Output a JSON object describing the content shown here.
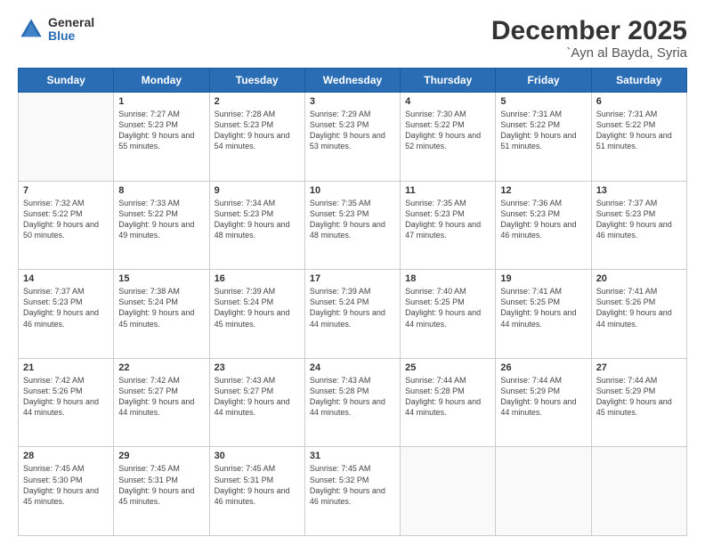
{
  "logo": {
    "general": "General",
    "blue": "Blue"
  },
  "header": {
    "month": "December 2025",
    "location": "`Ayn al Bayda, Syria"
  },
  "weekdays": [
    "Sunday",
    "Monday",
    "Tuesday",
    "Wednesday",
    "Thursday",
    "Friday",
    "Saturday"
  ],
  "weeks": [
    [
      {
        "day": "",
        "sunrise": "",
        "sunset": "",
        "daylight": ""
      },
      {
        "day": "1",
        "sunrise": "Sunrise: 7:27 AM",
        "sunset": "Sunset: 5:23 PM",
        "daylight": "Daylight: 9 hours and 55 minutes."
      },
      {
        "day": "2",
        "sunrise": "Sunrise: 7:28 AM",
        "sunset": "Sunset: 5:23 PM",
        "daylight": "Daylight: 9 hours and 54 minutes."
      },
      {
        "day": "3",
        "sunrise": "Sunrise: 7:29 AM",
        "sunset": "Sunset: 5:23 PM",
        "daylight": "Daylight: 9 hours and 53 minutes."
      },
      {
        "day": "4",
        "sunrise": "Sunrise: 7:30 AM",
        "sunset": "Sunset: 5:22 PM",
        "daylight": "Daylight: 9 hours and 52 minutes."
      },
      {
        "day": "5",
        "sunrise": "Sunrise: 7:31 AM",
        "sunset": "Sunset: 5:22 PM",
        "daylight": "Daylight: 9 hours and 51 minutes."
      },
      {
        "day": "6",
        "sunrise": "Sunrise: 7:31 AM",
        "sunset": "Sunset: 5:22 PM",
        "daylight": "Daylight: 9 hours and 51 minutes."
      }
    ],
    [
      {
        "day": "7",
        "sunrise": "Sunrise: 7:32 AM",
        "sunset": "Sunset: 5:22 PM",
        "daylight": "Daylight: 9 hours and 50 minutes."
      },
      {
        "day": "8",
        "sunrise": "Sunrise: 7:33 AM",
        "sunset": "Sunset: 5:22 PM",
        "daylight": "Daylight: 9 hours and 49 minutes."
      },
      {
        "day": "9",
        "sunrise": "Sunrise: 7:34 AM",
        "sunset": "Sunset: 5:23 PM",
        "daylight": "Daylight: 9 hours and 48 minutes."
      },
      {
        "day": "10",
        "sunrise": "Sunrise: 7:35 AM",
        "sunset": "Sunset: 5:23 PM",
        "daylight": "Daylight: 9 hours and 48 minutes."
      },
      {
        "day": "11",
        "sunrise": "Sunrise: 7:35 AM",
        "sunset": "Sunset: 5:23 PM",
        "daylight": "Daylight: 9 hours and 47 minutes."
      },
      {
        "day": "12",
        "sunrise": "Sunrise: 7:36 AM",
        "sunset": "Sunset: 5:23 PM",
        "daylight": "Daylight: 9 hours and 46 minutes."
      },
      {
        "day": "13",
        "sunrise": "Sunrise: 7:37 AM",
        "sunset": "Sunset: 5:23 PM",
        "daylight": "Daylight: 9 hours and 46 minutes."
      }
    ],
    [
      {
        "day": "14",
        "sunrise": "Sunrise: 7:37 AM",
        "sunset": "Sunset: 5:23 PM",
        "daylight": "Daylight: 9 hours and 46 minutes."
      },
      {
        "day": "15",
        "sunrise": "Sunrise: 7:38 AM",
        "sunset": "Sunset: 5:24 PM",
        "daylight": "Daylight: 9 hours and 45 minutes."
      },
      {
        "day": "16",
        "sunrise": "Sunrise: 7:39 AM",
        "sunset": "Sunset: 5:24 PM",
        "daylight": "Daylight: 9 hours and 45 minutes."
      },
      {
        "day": "17",
        "sunrise": "Sunrise: 7:39 AM",
        "sunset": "Sunset: 5:24 PM",
        "daylight": "Daylight: 9 hours and 44 minutes."
      },
      {
        "day": "18",
        "sunrise": "Sunrise: 7:40 AM",
        "sunset": "Sunset: 5:25 PM",
        "daylight": "Daylight: 9 hours and 44 minutes."
      },
      {
        "day": "19",
        "sunrise": "Sunrise: 7:41 AM",
        "sunset": "Sunset: 5:25 PM",
        "daylight": "Daylight: 9 hours and 44 minutes."
      },
      {
        "day": "20",
        "sunrise": "Sunrise: 7:41 AM",
        "sunset": "Sunset: 5:26 PM",
        "daylight": "Daylight: 9 hours and 44 minutes."
      }
    ],
    [
      {
        "day": "21",
        "sunrise": "Sunrise: 7:42 AM",
        "sunset": "Sunset: 5:26 PM",
        "daylight": "Daylight: 9 hours and 44 minutes."
      },
      {
        "day": "22",
        "sunrise": "Sunrise: 7:42 AM",
        "sunset": "Sunset: 5:27 PM",
        "daylight": "Daylight: 9 hours and 44 minutes."
      },
      {
        "day": "23",
        "sunrise": "Sunrise: 7:43 AM",
        "sunset": "Sunset: 5:27 PM",
        "daylight": "Daylight: 9 hours and 44 minutes."
      },
      {
        "day": "24",
        "sunrise": "Sunrise: 7:43 AM",
        "sunset": "Sunset: 5:28 PM",
        "daylight": "Daylight: 9 hours and 44 minutes."
      },
      {
        "day": "25",
        "sunrise": "Sunrise: 7:44 AM",
        "sunset": "Sunset: 5:28 PM",
        "daylight": "Daylight: 9 hours and 44 minutes."
      },
      {
        "day": "26",
        "sunrise": "Sunrise: 7:44 AM",
        "sunset": "Sunset: 5:29 PM",
        "daylight": "Daylight: 9 hours and 44 minutes."
      },
      {
        "day": "27",
        "sunrise": "Sunrise: 7:44 AM",
        "sunset": "Sunset: 5:29 PM",
        "daylight": "Daylight: 9 hours and 45 minutes."
      }
    ],
    [
      {
        "day": "28",
        "sunrise": "Sunrise: 7:45 AM",
        "sunset": "Sunset: 5:30 PM",
        "daylight": "Daylight: 9 hours and 45 minutes."
      },
      {
        "day": "29",
        "sunrise": "Sunrise: 7:45 AM",
        "sunset": "Sunset: 5:31 PM",
        "daylight": "Daylight: 9 hours and 45 minutes."
      },
      {
        "day": "30",
        "sunrise": "Sunrise: 7:45 AM",
        "sunset": "Sunset: 5:31 PM",
        "daylight": "Daylight: 9 hours and 46 minutes."
      },
      {
        "day": "31",
        "sunrise": "Sunrise: 7:45 AM",
        "sunset": "Sunset: 5:32 PM",
        "daylight": "Daylight: 9 hours and 46 minutes."
      },
      {
        "day": "",
        "sunrise": "",
        "sunset": "",
        "daylight": ""
      },
      {
        "day": "",
        "sunrise": "",
        "sunset": "",
        "daylight": ""
      },
      {
        "day": "",
        "sunrise": "",
        "sunset": "",
        "daylight": ""
      }
    ]
  ]
}
